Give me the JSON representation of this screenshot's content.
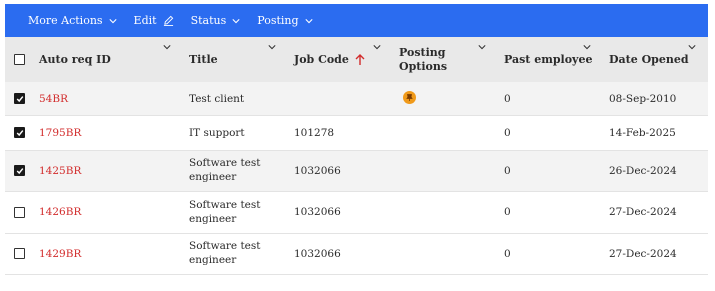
{
  "toolbar": {
    "items": [
      "More Actions",
      "Edit",
      "Status",
      "Posting"
    ],
    "background": "#2b6cf0"
  },
  "table": {
    "columns": [
      "Auto req ID",
      "Title",
      "Job Code",
      "Posting Options",
      "Past employee",
      "Date Opened"
    ],
    "sort": {
      "column": "Job Code",
      "direction": "ascending",
      "icon": "arrow-up-icon"
    },
    "rows": [
      {
        "checked": true,
        "id": "54BR",
        "title": "Test client",
        "job_code": "",
        "posting_icon": "pin-icon",
        "past_employee": "0",
        "date_opened": "08-Sep-2010"
      },
      {
        "checked": true,
        "id": "1795BR",
        "title": "IT support",
        "job_code": "101278",
        "posting_icon": "",
        "past_employee": "0",
        "date_opened": "14-Feb-2025"
      },
      {
        "checked": true,
        "id": "1425BR",
        "title": "Software test engineer",
        "job_code": "1032066",
        "posting_icon": "",
        "past_employee": "0",
        "date_opened": "26-Dec-2024"
      },
      {
        "checked": false,
        "id": "1426BR",
        "title": "Software test engineer",
        "job_code": "1032066",
        "posting_icon": "",
        "past_employee": "0",
        "date_opened": "27-Dec-2024"
      },
      {
        "checked": false,
        "id": "1429BR",
        "title": "Software test engineer",
        "job_code": "1032066",
        "posting_icon": "",
        "past_employee": "0",
        "date_opened": "27-Dec-2024"
      }
    ]
  },
  "colors": {
    "link": "#d22c2c",
    "sort_arrow": "#d22c2c",
    "pin": "#f09a1a"
  }
}
